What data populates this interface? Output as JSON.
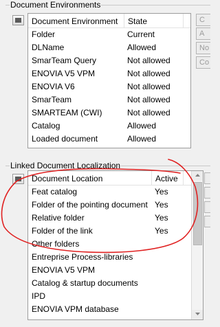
{
  "document_environments": {
    "group_title": "Document Environments",
    "columns": {
      "environment": "Document Environment",
      "state": "State"
    },
    "rows": [
      {
        "environment": "Folder",
        "state": "Current"
      },
      {
        "environment": "DLName",
        "state": "Allowed"
      },
      {
        "environment": "SmarTeam Query",
        "state": "Not allowed"
      },
      {
        "environment": "ENOVIA V5 VPM",
        "state": "Not allowed"
      },
      {
        "environment": "ENOVIA V6",
        "state": "Not allowed"
      },
      {
        "environment": "SmarTeam",
        "state": "Not allowed"
      },
      {
        "environment": "SMARTEAM (CWI)",
        "state": "Not allowed"
      },
      {
        "environment": "Catalog",
        "state": "Allowed"
      },
      {
        "environment": "Loaded document",
        "state": "Allowed"
      }
    ],
    "side_buttons": [
      "C",
      "A",
      "No",
      "Co"
    ]
  },
  "linked_document_localization": {
    "group_title": "Linked Document Localization",
    "columns": {
      "location": "Document Location",
      "active": "Active"
    },
    "rows": [
      {
        "location": "Feat catalog",
        "active": "Yes"
      },
      {
        "location": "Folder of the pointing document",
        "active": "Yes"
      },
      {
        "location": "Relative folder",
        "active": "Yes"
      },
      {
        "location": "Folder of the link",
        "active": "Yes"
      },
      {
        "location": "Other folders",
        "active": ""
      },
      {
        "location": "Entreprise Process-libraries",
        "active": ""
      },
      {
        "location": "ENOVIA V5 VPM",
        "active": ""
      },
      {
        "location": "Catalog & startup documents",
        "active": ""
      },
      {
        "location": "IPD",
        "active": ""
      },
      {
        "location": "ENOVIA VPM  database",
        "active": ""
      }
    ]
  },
  "colors": {
    "annotation": "#e02020",
    "window_bg": "#f0f0f0"
  }
}
